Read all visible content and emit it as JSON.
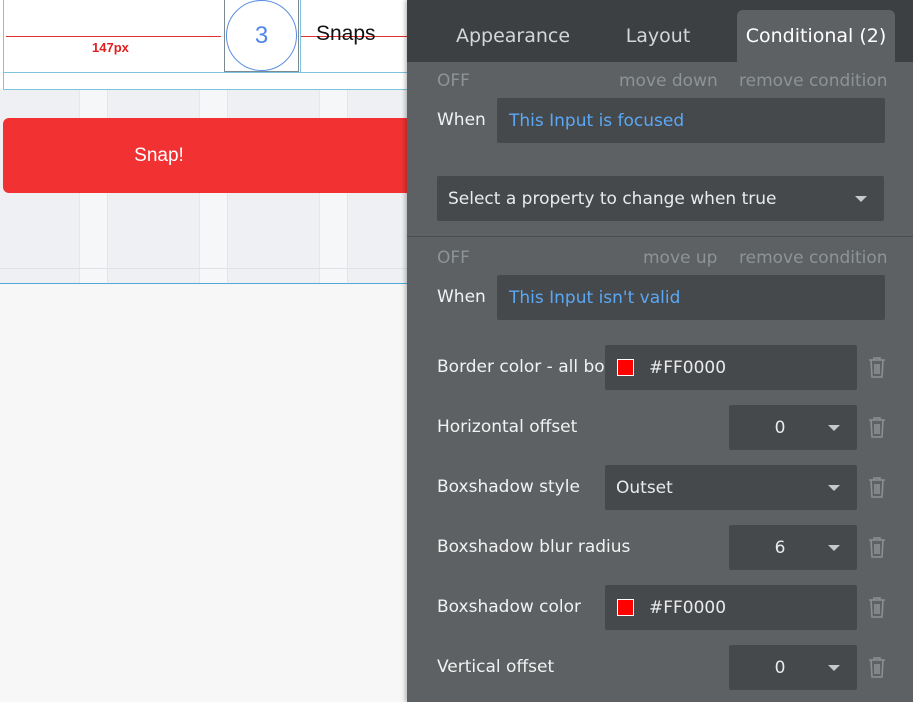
{
  "canvas": {
    "measure_label": "147px",
    "number_circle": "3",
    "snaps_label": "Snaps",
    "snap_button_label": "Snap!"
  },
  "tabs": {
    "appearance": "Appearance",
    "layout": "Layout",
    "conditional": "Conditional (2)"
  },
  "condition1": {
    "status": "OFF",
    "move_label": "move down",
    "remove_label": "remove condition",
    "when_label": "When",
    "expression": "This Input is focused",
    "property_placeholder": "Select a property to change when true"
  },
  "condition2": {
    "status": "OFF",
    "move_label": "move up",
    "remove_label": "remove condition",
    "when_label": "When",
    "expression": "This Input isn't valid",
    "properties": {
      "border_color": {
        "label": "Border color - all borders",
        "value": "#FF0000",
        "swatch_color": "#FF0000"
      },
      "horizontal_offset": {
        "label": "Horizontal offset",
        "value": "0"
      },
      "boxshadow_style": {
        "label": "Boxshadow style",
        "value": "Outset"
      },
      "boxshadow_blur_radius": {
        "label": "Boxshadow blur radius",
        "value": "6"
      },
      "boxshadow_color": {
        "label": "Boxshadow color",
        "value": "#FF0000",
        "swatch_color": "#FF0000"
      },
      "vertical_offset": {
        "label": "Vertical offset",
        "value": "0"
      }
    }
  },
  "colors": {
    "accent_red": "#F23232",
    "link_blue": "#5AA8F5",
    "panel_bg": "#5D6163",
    "tab_bar_bg": "#3C4043"
  },
  "icons": [
    "trash-icon",
    "chevron-down-icon"
  ]
}
